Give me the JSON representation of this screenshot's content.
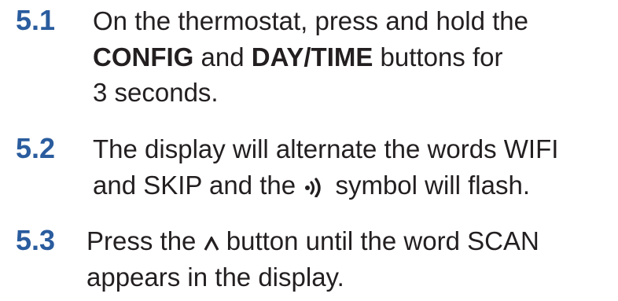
{
  "steps": [
    {
      "number": "5.1",
      "line1": "On the thermostat, press and hold the",
      "config": "CONFIG",
      "and": " and ",
      "daytime": "DAY/TIME",
      "buttons_for": " buttons for",
      "line3": "3 seconds."
    },
    {
      "number": "5.2",
      "line1": "The display will alternate the words WIFI",
      "line2_pre": "and SKIP and the ",
      "line2_icon": "wifi-signal-icon",
      "line2_post": " symbol will flash."
    },
    {
      "number": "5.3",
      "line1_pre": "Press the ",
      "line1_icon": "up-caret-icon",
      "line1_post": " button until the word SCAN",
      "line2": "appears in the display."
    }
  ],
  "colors": {
    "step_number": "#2a5c9e",
    "text": "#231f20"
  }
}
